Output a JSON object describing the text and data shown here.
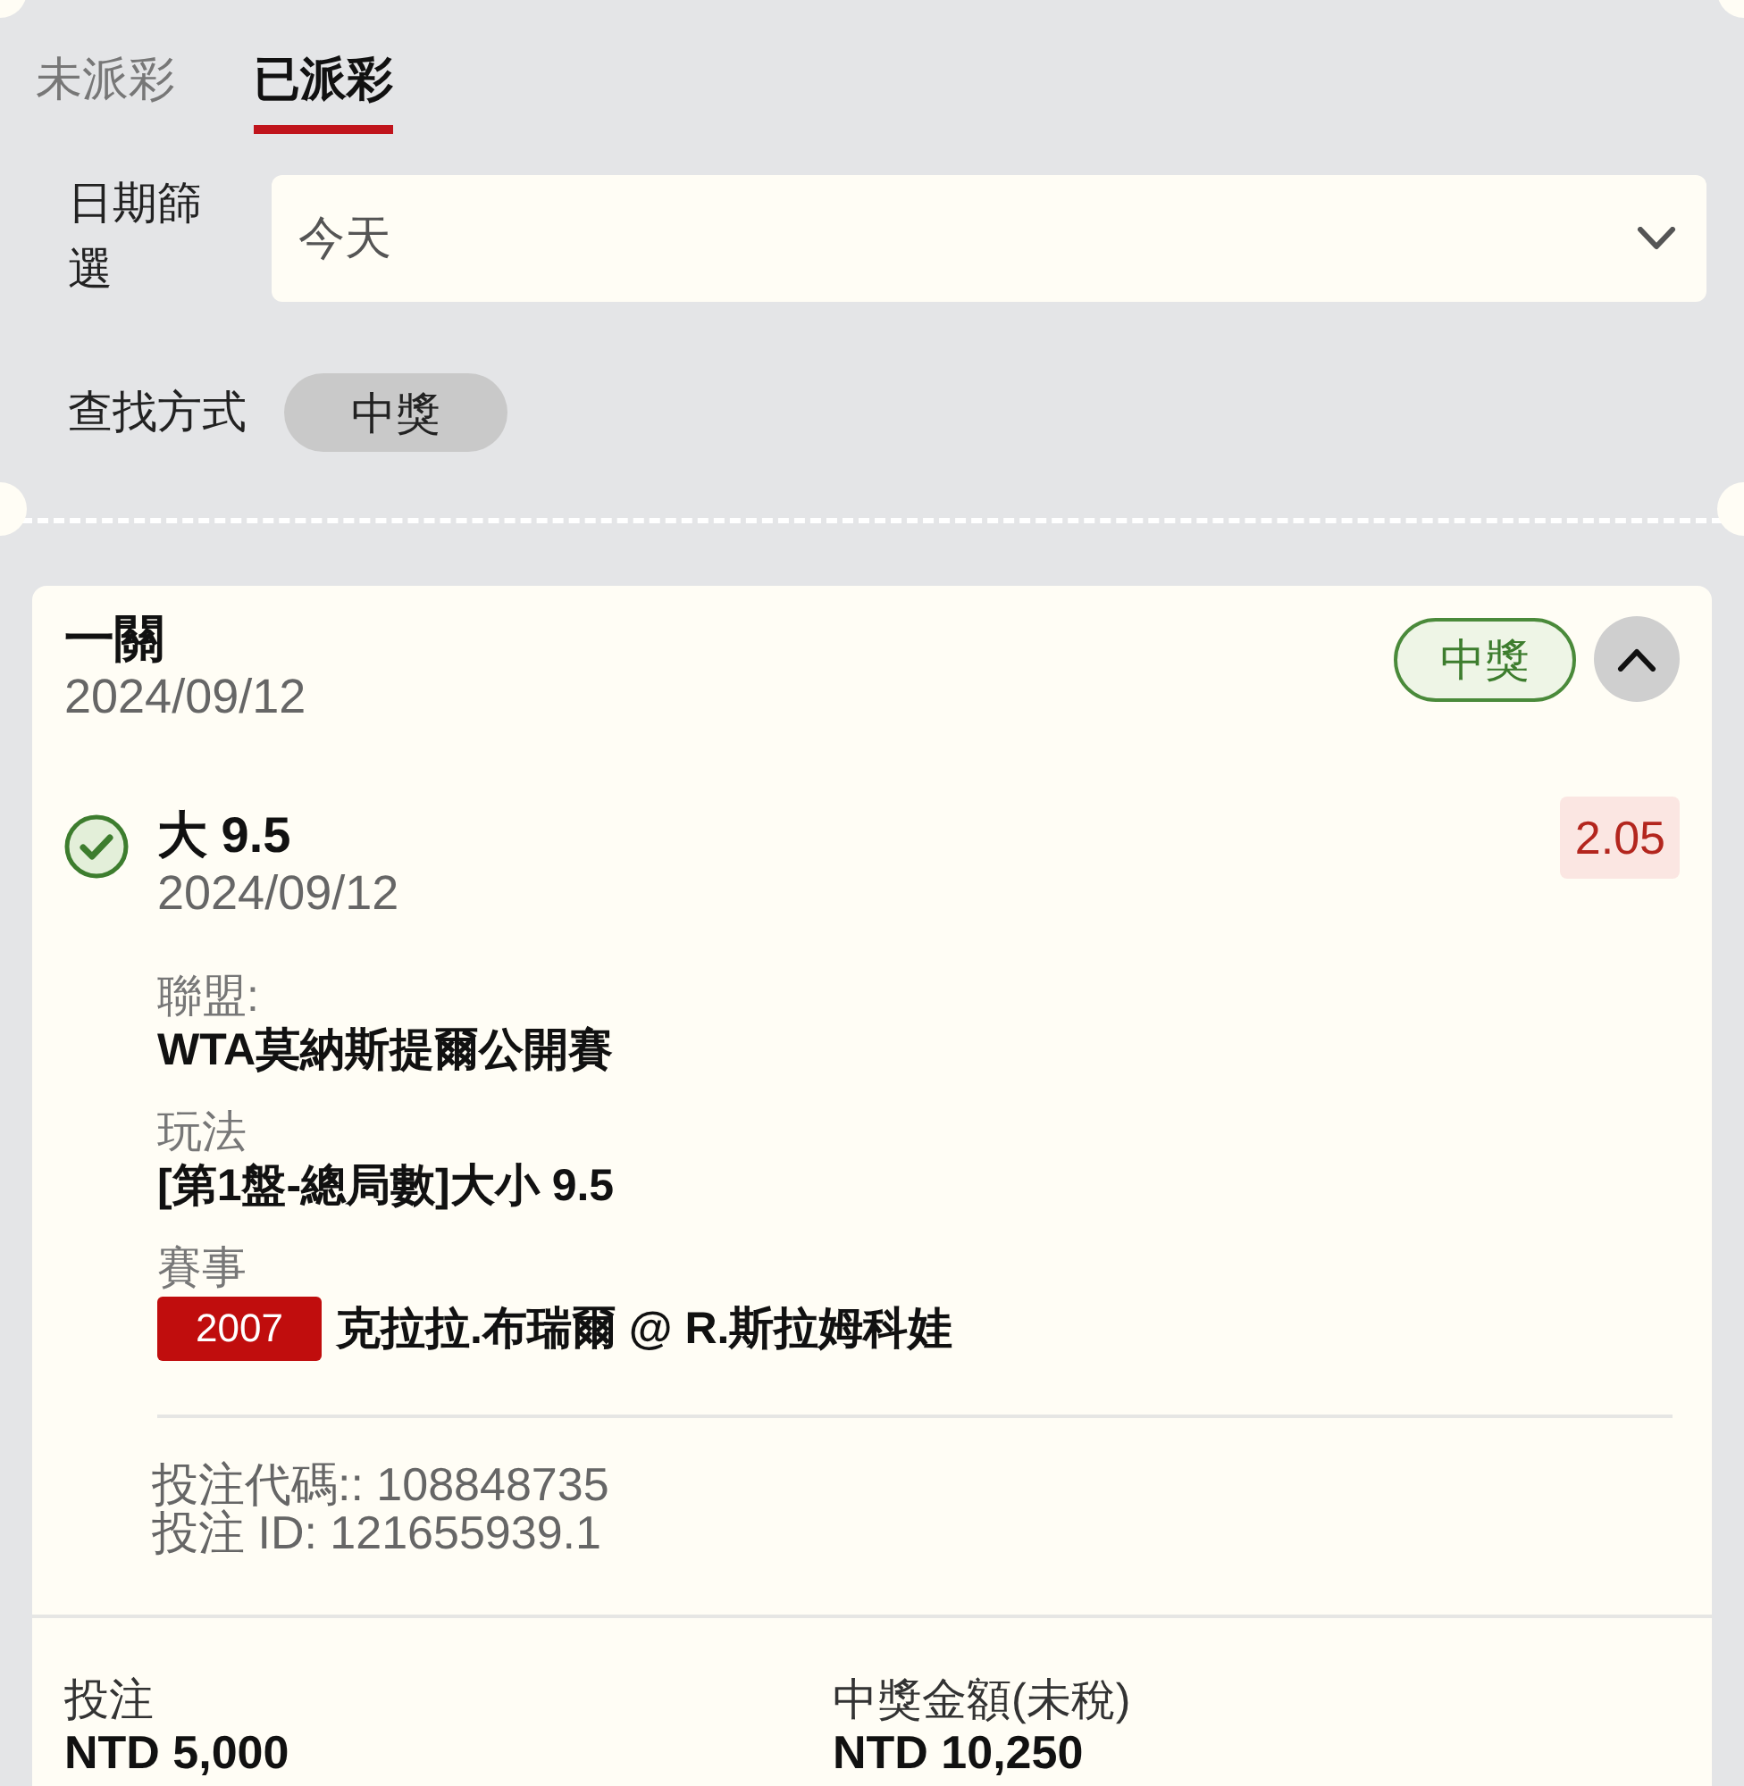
{
  "tabs": [
    {
      "label": "未派彩",
      "selected": false
    },
    {
      "label": "已派彩",
      "selected": true
    }
  ],
  "filters": {
    "date": {
      "label": "日期篩選",
      "value": "今天"
    },
    "search_by": {
      "label": "查找方式",
      "chips": [
        {
          "label": "中獎",
          "selected": true
        }
      ]
    }
  },
  "bet_card": {
    "type": "一關",
    "date": "2024/09/12",
    "status": {
      "label": "中獎",
      "kind": "won"
    },
    "expanded": true,
    "selections": [
      {
        "kind": "won",
        "pick": "大 9.5",
        "date": "2024/09/12",
        "odds": "2.05",
        "league_label": "聯盟:",
        "league": "WTA莫納斯提爾公開賽",
        "market_label": "玩法",
        "market": "[第1盤-總局數]大小 9.5",
        "event_label": "賽事",
        "event_code": "2007",
        "event": "克拉拉.布瑞爾 @ R.斯拉姆科娃"
      }
    ],
    "bet_code": "投注代碼:: 108848735",
    "bet_id": "投注 ID: 121655939.1",
    "summary": [
      {
        "label": "投注",
        "value": "NTD 5,000"
      },
      {
        "label": "中獎金額(未稅)",
        "value": "NTD 10,250"
      }
    ]
  }
}
